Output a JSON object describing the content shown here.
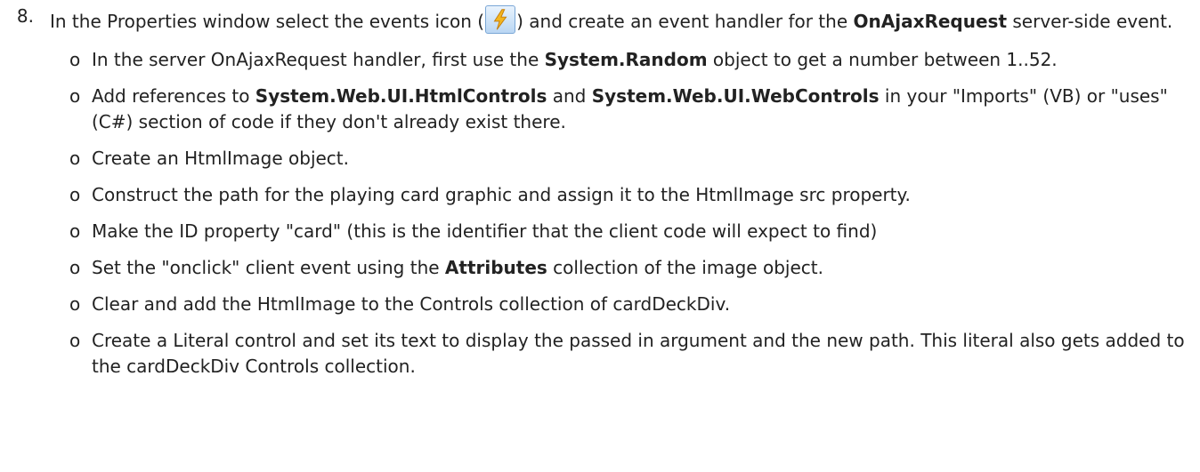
{
  "step": {
    "number": "8.",
    "text_before_icon": "In the Properties window select the events icon (",
    "text_after_icon": ") and create an event handler for the ",
    "event_name": "OnAjaxRequest",
    "text_end": " server-side event.",
    "icon": "lightning-bolt-icon"
  },
  "bullet_glyph": "o",
  "bullets": [
    {
      "p1": "In the server OnAjaxRequest handler, first use the ",
      "b1": "System.Random",
      "p2": " object to get a number between 1..52."
    },
    {
      "p1": "Add references to ",
      "b1": "System.Web.UI.HtmlControls",
      "p2": " and ",
      "b2": "System.Web.UI.WebControls",
      "p3": " in your \"Imports\" (VB) or \"uses\" (C#) section of code if they don't already exist there."
    },
    {
      "p1": "Create an HtmlImage object."
    },
    {
      "p1": "Construct the path for the playing card graphic and assign it to the HtmlImage src property."
    },
    {
      "p1": "Make the ID property \"card\" (this is the identifier that the client code will expect to find)"
    },
    {
      "p1": "Set the \"onclick\" client event using the ",
      "b1": "Attributes",
      "p2": " collection of the image object."
    },
    {
      "p1": "Clear and add the HtmlImage to the Controls collection of cardDeckDiv."
    },
    {
      "p1": "Create a Literal control and set its text to display the passed in argument and the new path. This literal also gets added to the cardDeckDiv Controls collection."
    }
  ],
  "colors": {
    "text": "#222222",
    "icon_bg": "#cfe3f8",
    "bolt": "#f3b61f"
  }
}
